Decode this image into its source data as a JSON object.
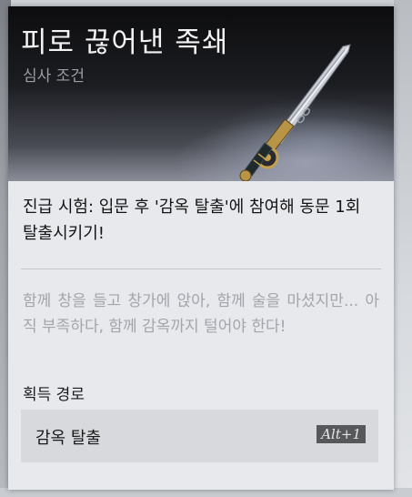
{
  "item": {
    "title": "피로 끊어낸 족쇄",
    "subtitle": "심사 조건",
    "image_icon": "sword-icon"
  },
  "requirement": {
    "text": "진급 시험: 입문 후 '감옥 탈출'에 참여해 동문 1회 탈출시키기!"
  },
  "flavor": {
    "text": "함께 창을 들고 창가에 앉아, 함께 술을 마셨지만... 아직 부족하다, 함께 감옥까지 털어야 한다!"
  },
  "acquisition": {
    "heading": "획득 경로",
    "sources": [
      {
        "label": "감옥 탈출",
        "shortcut": "Alt+1"
      }
    ]
  },
  "colors": {
    "card_bg": "#e9eaed",
    "source_row_bg": "#d8d9dd",
    "shortcut_bg": "#575859"
  }
}
